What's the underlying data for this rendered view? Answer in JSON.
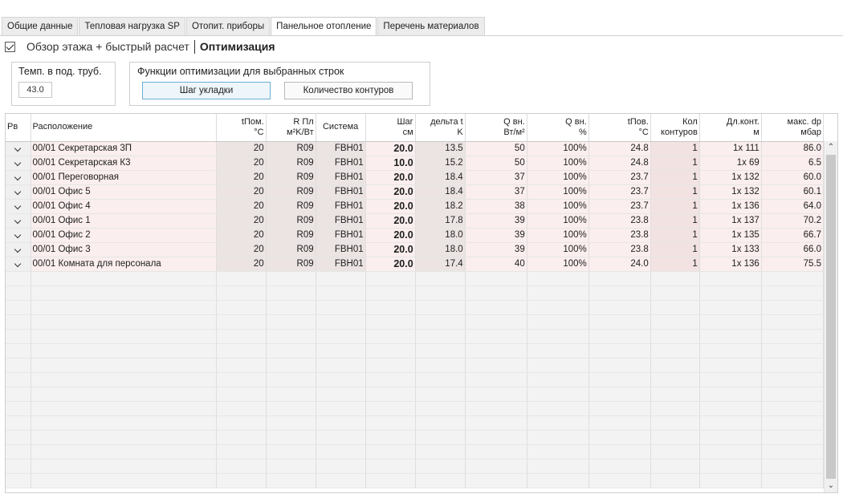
{
  "tabs": [
    {
      "label": "Общие данные"
    },
    {
      "label": "Тепловая нагрузка SP"
    },
    {
      "label": "Отопит. приборы"
    },
    {
      "label": "Панельное отопление"
    },
    {
      "label": "Перечень материалов"
    }
  ],
  "active_tab": 3,
  "toolbar": {
    "overview_label": "Обзор этажа + быстрый расчет",
    "optimization_label": "Оптимизация",
    "overview_checked": true
  },
  "temp_box": {
    "label": "Темп. в под. труб.",
    "value": "43.0"
  },
  "func_box": {
    "label": "Функции оптимизации для выбранных строк",
    "step_button": "Шаг укладки",
    "contours_button": "Количество контуров"
  },
  "grid": {
    "headers": [
      {
        "l1": "Рв",
        "l2": ""
      },
      {
        "l1": "Расположение",
        "l2": ""
      },
      {
        "l1": "tПом.",
        "l2": "°C"
      },
      {
        "l1": "R Пл",
        "l2": "м²K/Вт"
      },
      {
        "l1": "Система",
        "l2": ""
      },
      {
        "l1": "Шаг",
        "l2": "см"
      },
      {
        "l1": "дельта t",
        "l2": "K"
      },
      {
        "l1": "Q вн.",
        "l2": "Вт/м²"
      },
      {
        "l1": "Q вн.",
        "l2": "%"
      },
      {
        "l1": "tПов.",
        "l2": "°C"
      },
      {
        "l1": "Кол",
        "l2": "контуров"
      },
      {
        "l1": "Дл.конт.",
        "l2": "м"
      },
      {
        "l1": "макс. dp",
        "l2": "мбар"
      }
    ],
    "rows": [
      {
        "loc": "00/01 Секретарская 3П",
        "t": "20",
        "r": "R09",
        "sys": "FBH01",
        "step": "20.0",
        "dt": "13.5",
        "q": "50",
        "qp": "100%",
        "tp": "24.8",
        "n": "1",
        "len": "1x 111",
        "dp": "86.0"
      },
      {
        "loc": "00/01 Секретарская К3",
        "t": "20",
        "r": "R09",
        "sys": "FBH01",
        "step": "10.0",
        "dt": "15.2",
        "q": "50",
        "qp": "100%",
        "tp": "24.8",
        "n": "1",
        "len": "1x 69",
        "dp": "6.5"
      },
      {
        "loc": "00/01 Переговорная",
        "t": "20",
        "r": "R09",
        "sys": "FBH01",
        "step": "20.0",
        "dt": "18.4",
        "q": "37",
        "qp": "100%",
        "tp": "23.7",
        "n": "1",
        "len": "1x 132",
        "dp": "60.0"
      },
      {
        "loc": "00/01 Офис 5",
        "t": "20",
        "r": "R09",
        "sys": "FBH01",
        "step": "20.0",
        "dt": "18.4",
        "q": "37",
        "qp": "100%",
        "tp": "23.7",
        "n": "1",
        "len": "1x 132",
        "dp": "60.1"
      },
      {
        "loc": "00/01 Офис 4",
        "t": "20",
        "r": "R09",
        "sys": "FBH01",
        "step": "20.0",
        "dt": "18.2",
        "q": "38",
        "qp": "100%",
        "tp": "23.7",
        "n": "1",
        "len": "1x 136",
        "dp": "64.0"
      },
      {
        "loc": "00/01 Офис 1",
        "t": "20",
        "r": "R09",
        "sys": "FBH01",
        "step": "20.0",
        "dt": "17.8",
        "q": "39",
        "qp": "100%",
        "tp": "23.8",
        "n": "1",
        "len": "1x 137",
        "dp": "70.2"
      },
      {
        "loc": "00/01 Офис 2",
        "t": "20",
        "r": "R09",
        "sys": "FBH01",
        "step": "20.0",
        "dt": "18.0",
        "q": "39",
        "qp": "100%",
        "tp": "23.8",
        "n": "1",
        "len": "1x 135",
        "dp": "66.7"
      },
      {
        "loc": "00/01 Офис 3",
        "t": "20",
        "r": "R09",
        "sys": "FBH01",
        "step": "20.0",
        "dt": "18.0",
        "q": "39",
        "qp": "100%",
        "tp": "23.8",
        "n": "1",
        "len": "1x 133",
        "dp": "66.0"
      },
      {
        "loc": "00/01 Комната для персонала",
        "t": "20",
        "r": "R09",
        "sys": "FBH01",
        "step": "20.0",
        "dt": "17.4",
        "q": "40",
        "qp": "100%",
        "tp": "24.0",
        "n": "1",
        "len": "1x 136",
        "dp": "75.5"
      }
    ],
    "empty_rows": 15
  },
  "icons": {
    "row_expand": "chevron-down-icon",
    "scroll_up": "chevron-up-icon",
    "scroll_down": "chevron-down-icon"
  },
  "colors": {
    "row_tint": "#fbeeee",
    "selected_button": "#6aaed6"
  }
}
